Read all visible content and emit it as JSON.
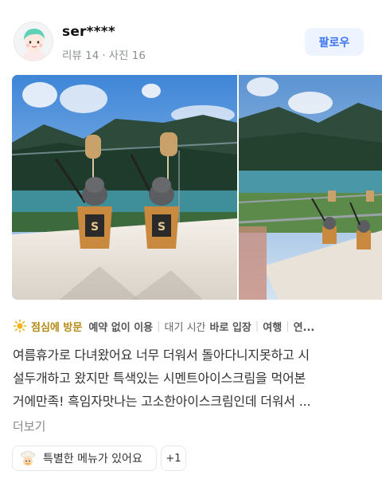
{
  "reviewer": {
    "name": "ser****",
    "reviews": "리뷰 14",
    "photos": "사진 16",
    "follow_label": "팔로우"
  },
  "photos": [
    {
      "icon": "photo-cement-ice-cream-mountain-lake"
    },
    {
      "icon": "photo-terrace-lake-view"
    }
  ],
  "tags": {
    "visit": "점심에 방문",
    "reservation": "예약 없이 이용",
    "wait_label": "대기 시간",
    "wait_value": "바로 입장",
    "purpose": "여행",
    "overflow": "연..."
  },
  "review_lines": [
    "여름휴가로 다녀왔어요 너무 더워서 돌아다니지못하고 시",
    "설두개하고 왔지만 특색있는 시멘트아이스크림을 먹어본",
    "거에만족! 흑임자맛나는 고소한아이스크림인데 더워서 ..."
  ],
  "more_label": "더보기",
  "chips": {
    "keyword": "특별한 메뉴가 있어요",
    "extra": "+1"
  },
  "colors": {
    "accent": "#3a74f2",
    "visit": "#b58a14"
  }
}
